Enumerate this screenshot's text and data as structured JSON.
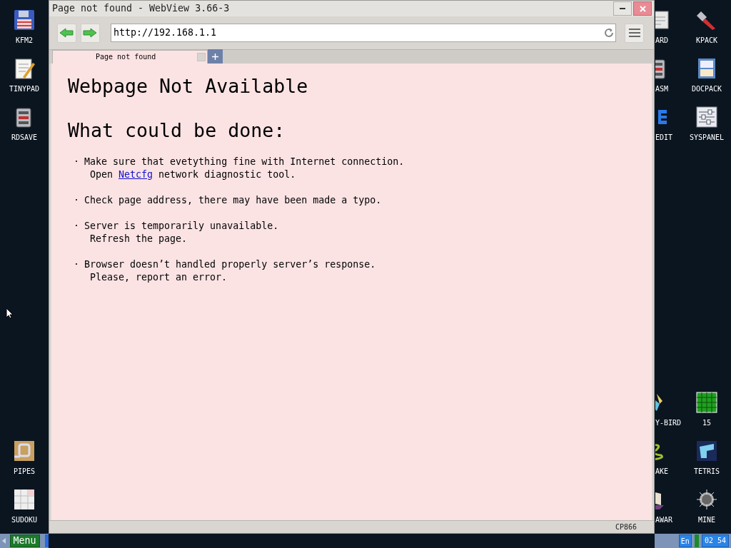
{
  "desktop": {
    "left_icons": [
      {
        "label": "KFM2",
        "kind": "floppy"
      },
      {
        "label": "TINYPAD",
        "kind": "notepad"
      },
      {
        "label": "RDSAVE",
        "kind": "drive"
      },
      {
        "label": "PIPES",
        "kind": "pipes"
      },
      {
        "label": "SUDOKU",
        "kind": "sudoku"
      }
    ],
    "middle_icons": [
      {
        "label": "ARD",
        "kind": "window"
      },
      {
        "label": "ASM",
        "kind": "drive"
      },
      {
        "label": "EDIT",
        "kind": "letters"
      },
      {
        "label": "Y-BIRD",
        "kind": "bird"
      },
      {
        "label": "AKE",
        "kind": "snake"
      },
      {
        "label": "AWAR",
        "kind": "ship"
      }
    ],
    "right_icons": [
      {
        "label": "KPACK",
        "kind": "wrench"
      },
      {
        "label": "DOCPACK",
        "kind": "cabinet"
      },
      {
        "label": "SYSPANEL",
        "kind": "sliders"
      },
      {
        "label": "15",
        "kind": "grid"
      },
      {
        "label": "TETRIS",
        "kind": "blocks"
      },
      {
        "label": "MINE",
        "kind": "mine"
      }
    ]
  },
  "window": {
    "title": "Page not found - WebView 3.66-3",
    "url": "http://192.168.1.1",
    "tabs": [
      {
        "label": "Page not found",
        "selected": true
      }
    ],
    "heading": "Webpage Not Available",
    "subheading": "What could be done:",
    "items": [
      {
        "bullet": "·",
        "lines": [
          {
            "text": "Make sure that evetything fine with Internet connection."
          },
          {
            "before": "Open ",
            "link": "Netcfg",
            "after": " network diagnostic tool."
          }
        ]
      },
      {
        "bullet": "·",
        "lines": [
          {
            "text": "Check page address, there may have been made a typo."
          }
        ]
      },
      {
        "bullet": "·",
        "lines": [
          {
            "text": "Server is temporarily unavailable."
          },
          {
            "text": "Refresh the page."
          }
        ]
      },
      {
        "bullet": "·",
        "lines": [
          {
            "text": "Browser doesn’t handled properly server’s response."
          },
          {
            "text": "Please, report an error."
          }
        ]
      }
    ],
    "status_bar": "CP866"
  },
  "taskbar": {
    "menu": "Menu",
    "language": "En",
    "clock": "02 54"
  }
}
